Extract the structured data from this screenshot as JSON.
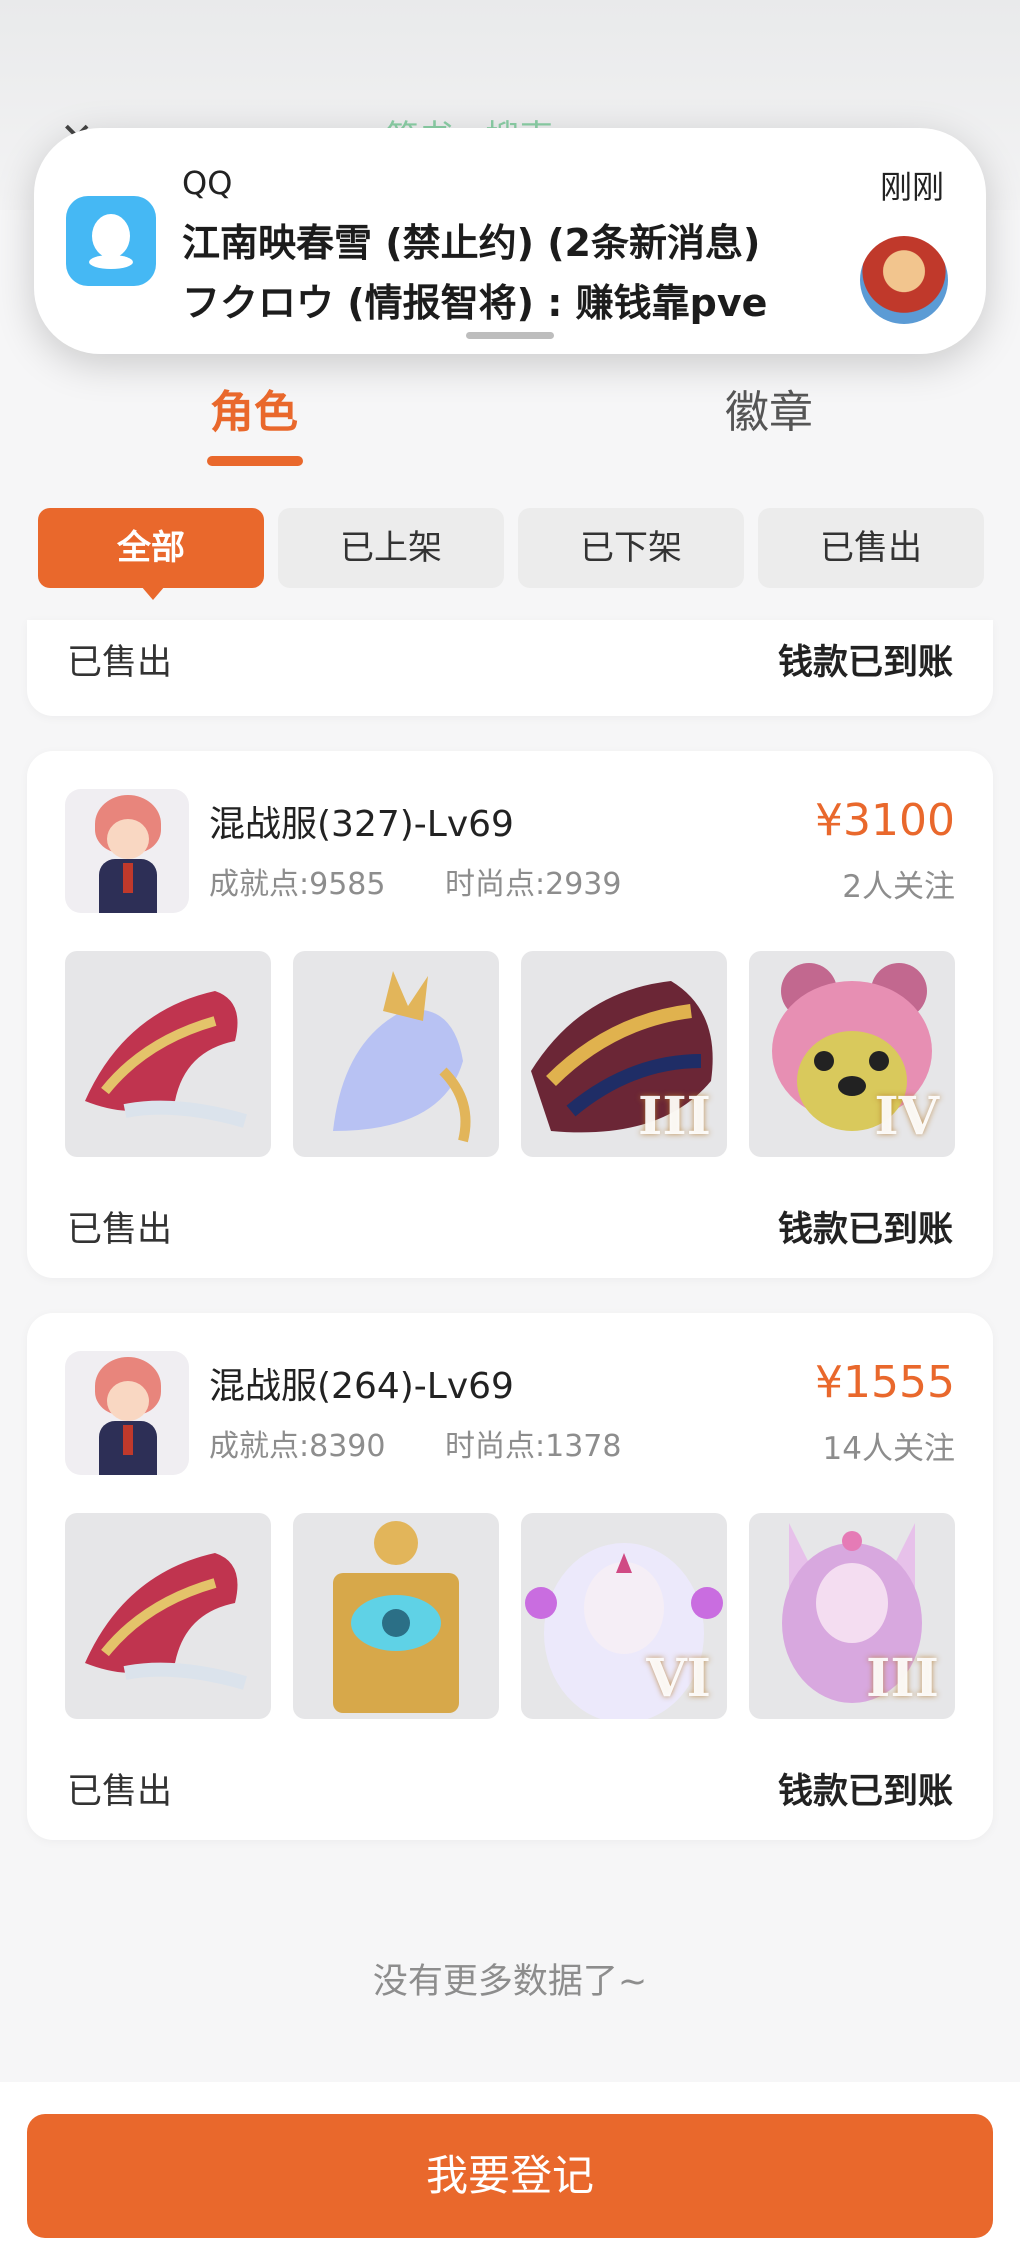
{
  "header": {
    "peek_title": "简书.. 搜索"
  },
  "notification": {
    "app_name": "QQ",
    "time": "刚刚",
    "line1": "江南映春雪 (禁止约) (2条新消息)",
    "line2": "フクロウ (情报智将) : 赚钱靠pve"
  },
  "tabs": [
    {
      "label": "角色"
    },
    {
      "label": "徽章"
    }
  ],
  "filters": [
    {
      "label": "全部"
    },
    {
      "label": "已上架"
    },
    {
      "label": "已下架"
    },
    {
      "label": "已售出"
    }
  ],
  "partial_card": {
    "status": "已售出",
    "payment": "钱款已到账"
  },
  "listings": [
    {
      "server": "混战服(327)-Lv69",
      "achievement": "成就点:9585",
      "fashion": "时尚点:2939",
      "price": "¥3100",
      "followers": "2人关注",
      "items": [
        {
          "name": "red-dragon",
          "rank": "",
          "color": "#c0344f"
        },
        {
          "name": "ice-horse",
          "rank": "",
          "color": "#a9b7ef"
        },
        {
          "name": "gold-dragon",
          "rank": "III",
          "color": "#6b2636"
        },
        {
          "name": "pink-bear",
          "rank": "IV",
          "color": "#e78fb3"
        }
      ],
      "status": "已售出",
      "payment": "钱款已到账"
    },
    {
      "server": "混战服(264)-Lv69",
      "achievement": "成就点:8390",
      "fashion": "时尚点:1378",
      "price": "¥1555",
      "followers": "14人关注",
      "items": [
        {
          "name": "red-dragon",
          "rank": "",
          "color": "#c0344f"
        },
        {
          "name": "golden-throne",
          "rank": "",
          "color": "#d7a84a"
        },
        {
          "name": "white-spirit",
          "rank": "VI",
          "color": "#c9c6f2"
        },
        {
          "name": "pink-fox",
          "rank": "III",
          "color": "#d8a8df"
        }
      ],
      "status": "已售出",
      "payment": "钱款已到账"
    }
  ],
  "footer_note": "没有更多数据了~",
  "cta_label": "我要登记",
  "colors": {
    "accent": "#e9682c",
    "qq_blue": "#45b8f4"
  }
}
